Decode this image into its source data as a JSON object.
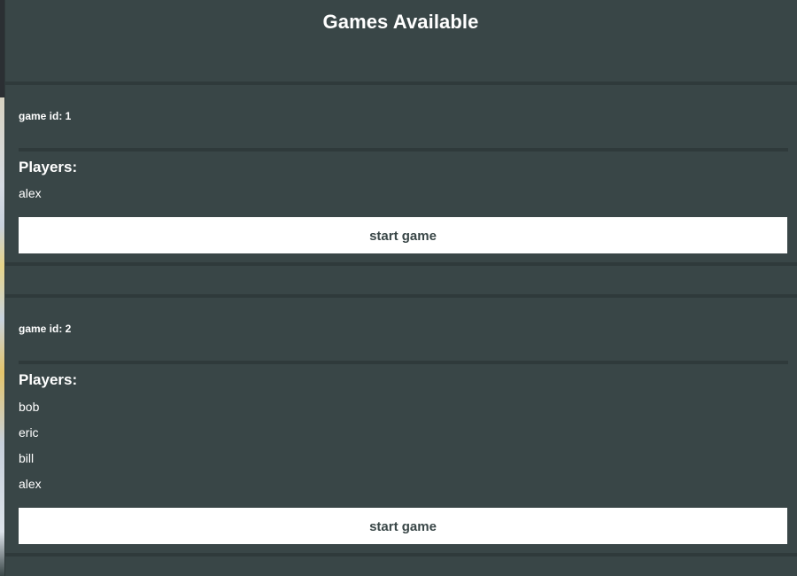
{
  "header": {
    "title": "Games Available"
  },
  "games": [
    {
      "game_id_label": "game id: 1",
      "players_label": "Players:",
      "players": [
        "alex"
      ],
      "button_label": "start game"
    },
    {
      "game_id_label": "game id: 2",
      "players_label": "Players:",
      "players": [
        "bob",
        "eric",
        "bill",
        "alex"
      ],
      "button_label": "start game"
    }
  ],
  "colors": {
    "background": "#394647",
    "separator": "#2f3a3b",
    "button_background": "#ffffff",
    "button_text": "#394647",
    "text": "#ffffff"
  }
}
